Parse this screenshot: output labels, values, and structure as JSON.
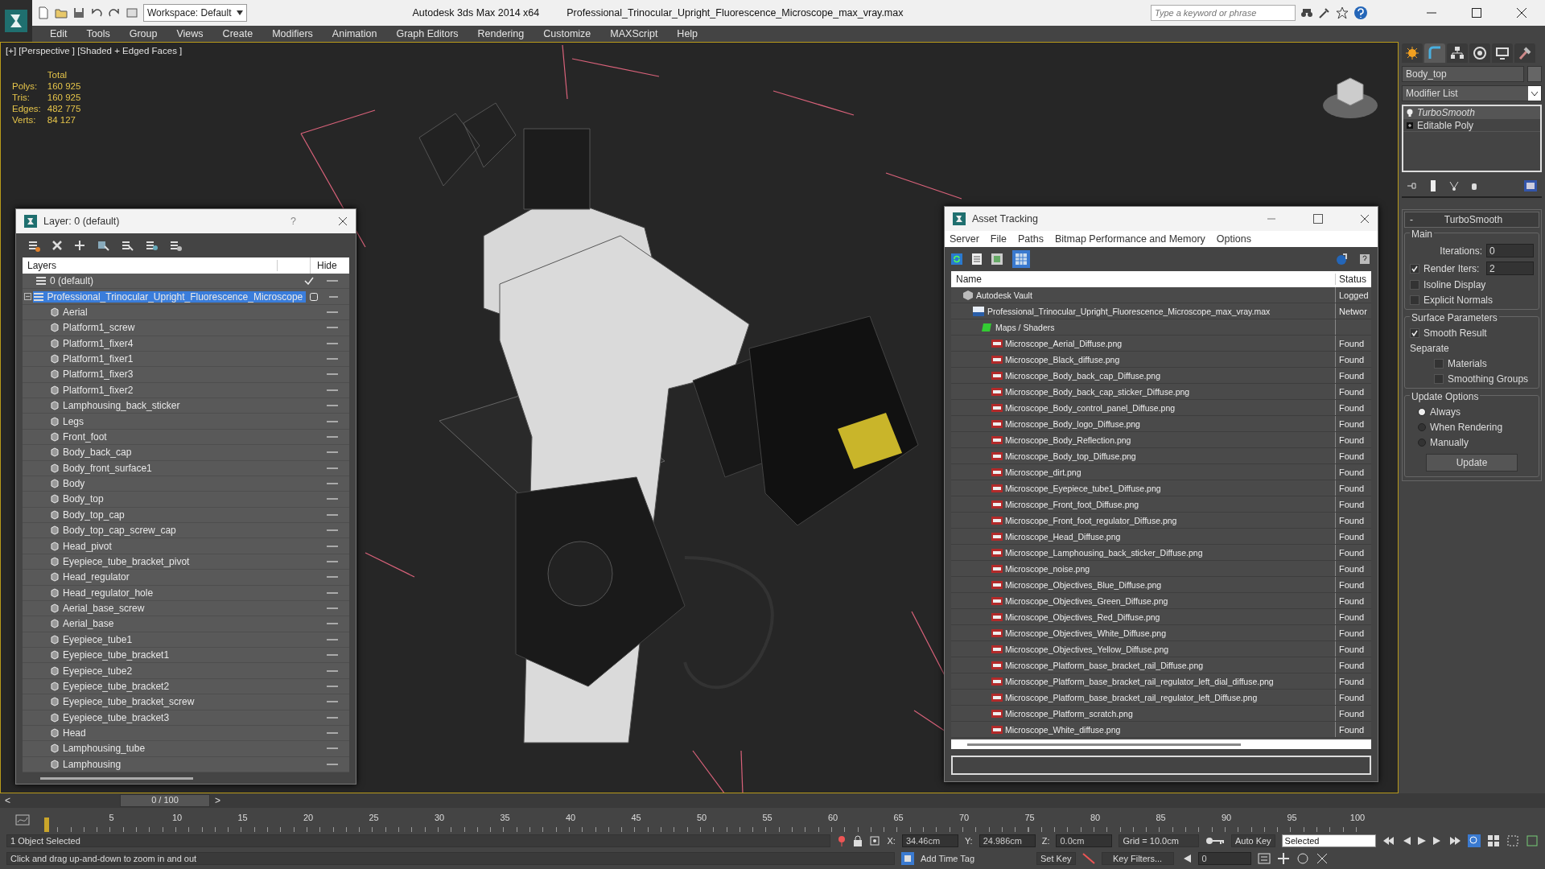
{
  "title_bar": {
    "workspace": "Workspace: Default",
    "app": "Autodesk 3ds Max  2014 x64",
    "file": "Professional_Trinocular_Upright_Fluorescence_Microscope_max_vray.max",
    "search": {
      "placeholder": "Type a keyword or phrase"
    }
  },
  "menu": [
    "Edit",
    "Tools",
    "Group",
    "Views",
    "Create",
    "Modifiers",
    "Animation",
    "Graph Editors",
    "Rendering",
    "Customize",
    "MAXScript",
    "Help"
  ],
  "viewport": {
    "label": "[+] [Perspective ] [Shaded + Edged Faces ]",
    "stats": {
      "heading": "Total",
      "rows": [
        {
          "label": "Polys:",
          "value": "160 925"
        },
        {
          "label": "Tris:",
          "value": "160 925"
        },
        {
          "label": "Edges:",
          "value": "482 775"
        },
        {
          "label": "Verts:",
          "value": "84 127"
        }
      ]
    }
  },
  "layer_window": {
    "title": "Layer: 0 (default)",
    "help": "?",
    "columns": [
      "Layers",
      "Hide"
    ],
    "layers": [
      {
        "name": "0 (default)",
        "selected": false,
        "active": true,
        "expanded": false
      },
      {
        "name": "Professional_Trinocular_Upright_Fluorescence_Microscope",
        "selected": true,
        "active": false,
        "expanded": true,
        "children": [
          {
            "name": "Aerial"
          },
          {
            "name": "Platform1_screw"
          },
          {
            "name": "Platform1_fixer4"
          },
          {
            "name": "Platform1_fixer1"
          },
          {
            "name": "Platform1_fixer3"
          },
          {
            "name": "Platform1_fixer2"
          },
          {
            "name": "Lamphousing_back_sticker"
          },
          {
            "name": "Legs"
          },
          {
            "name": "Front_foot"
          },
          {
            "name": "Body_back_cap"
          },
          {
            "name": "Body_front_surface1"
          },
          {
            "name": "Body"
          },
          {
            "name": "Body_top"
          },
          {
            "name": "Body_top_cap"
          },
          {
            "name": "Body_top_cap_screw_cap"
          },
          {
            "name": "Head_pivot"
          },
          {
            "name": "Eyepiece_tube_bracket_pivot"
          },
          {
            "name": "Head_regulator"
          },
          {
            "name": "Head_regulator_hole"
          },
          {
            "name": "Aerial_base_screw"
          },
          {
            "name": "Aerial_base"
          },
          {
            "name": "Eyepiece_tube1"
          },
          {
            "name": "Eyepiece_tube_bracket1"
          },
          {
            "name": "Eyepiece_tube2"
          },
          {
            "name": "Eyepiece_tube_bracket2"
          },
          {
            "name": "Eyepiece_tube_bracket_screw"
          },
          {
            "name": "Eyepiece_tube_bracket3"
          },
          {
            "name": "Head"
          },
          {
            "name": "Lamphousing_tube"
          },
          {
            "name": "Lamphousing"
          }
        ]
      }
    ]
  },
  "asset_window": {
    "title": "Asset Tracking",
    "menu": [
      "Server",
      "File",
      "Paths",
      "Bitmap Performance and Memory",
      "Options"
    ],
    "columns": [
      "Name",
      "Status"
    ],
    "assets": [
      {
        "kind": "vault",
        "name": "Autodesk Vault",
        "status": "Logged",
        "children": [
          {
            "kind": "max",
            "name": "Professional_Trinocular_Upright_Fluorescence_Microscope_max_vray.max",
            "status": "Networ",
            "children": [
              {
                "kind": "folder",
                "name": "Maps / Shaders",
                "children": [
                  {
                    "kind": "png",
                    "name": "Microscope_Aerial_Diffuse.png",
                    "status": "Found"
                  },
                  {
                    "kind": "png",
                    "name": "Microscope_Black_diffuse.png",
                    "status": "Found"
                  },
                  {
                    "kind": "png",
                    "name": "Microscope_Body_back_cap_Diffuse.png",
                    "status": "Found"
                  },
                  {
                    "kind": "png",
                    "name": "Microscope_Body_back_cap_sticker_Diffuse.png",
                    "status": "Found"
                  },
                  {
                    "kind": "png",
                    "name": "Microscope_Body_control_panel_Diffuse.png",
                    "status": "Found"
                  },
                  {
                    "kind": "png",
                    "name": "Microscope_Body_logo_Diffuse.png",
                    "status": "Found"
                  },
                  {
                    "kind": "png",
                    "name": "Microscope_Body_Reflection.png",
                    "status": "Found"
                  },
                  {
                    "kind": "png",
                    "name": "Microscope_Body_top_Diffuse.png",
                    "status": "Found"
                  },
                  {
                    "kind": "png",
                    "name": "Microscope_dirt.png",
                    "status": "Found"
                  },
                  {
                    "kind": "png",
                    "name": "Microscope_Eyepiece_tube1_Diffuse.png",
                    "status": "Found"
                  },
                  {
                    "kind": "png",
                    "name": "Microscope_Front_foot_Diffuse.png",
                    "status": "Found"
                  },
                  {
                    "kind": "png",
                    "name": "Microscope_Front_foot_regulator_Diffuse.png",
                    "status": "Found"
                  },
                  {
                    "kind": "png",
                    "name": "Microscope_Head_Diffuse.png",
                    "status": "Found"
                  },
                  {
                    "kind": "png",
                    "name": "Microscope_Lamphousing_back_sticker_Diffuse.png",
                    "status": "Found"
                  },
                  {
                    "kind": "png",
                    "name": "Microscope_noise.png",
                    "status": "Found"
                  },
                  {
                    "kind": "png",
                    "name": "Microscope_Objectives_Blue_Diffuse.png",
                    "status": "Found"
                  },
                  {
                    "kind": "png",
                    "name": "Microscope_Objectives_Green_Diffuse.png",
                    "status": "Found"
                  },
                  {
                    "kind": "png",
                    "name": "Microscope_Objectives_Red_Diffuse.png",
                    "status": "Found"
                  },
                  {
                    "kind": "png",
                    "name": "Microscope_Objectives_White_Diffuse.png",
                    "status": "Found"
                  },
                  {
                    "kind": "png",
                    "name": "Microscope_Objectives_Yellow_Diffuse.png",
                    "status": "Found"
                  },
                  {
                    "kind": "png",
                    "name": "Microscope_Platform_base_bracket_rail_Diffuse.png",
                    "status": "Found"
                  },
                  {
                    "kind": "png",
                    "name": "Microscope_Platform_base_bracket_rail_regulator_left_dial_diffuse.png",
                    "status": "Found"
                  },
                  {
                    "kind": "png",
                    "name": "Microscope_Platform_base_bracket_rail_regulator_left_Diffuse.png",
                    "status": "Found"
                  },
                  {
                    "kind": "png",
                    "name": "Microscope_Platform_scratch.png",
                    "status": "Found"
                  },
                  {
                    "kind": "png",
                    "name": "Microscope_White_diffuse.png",
                    "status": "Found"
                  }
                ]
              }
            ]
          }
        ]
      }
    ]
  },
  "command_panel": {
    "tabs": [
      {
        "kind": "create",
        "selected": false
      },
      {
        "kind": "modify",
        "selected": true
      },
      {
        "kind": "hierarchy",
        "selected": false
      },
      {
        "kind": "motion",
        "selected": false
      },
      {
        "kind": "display",
        "selected": false
      },
      {
        "kind": "utilities",
        "selected": false
      }
    ],
    "object_name": "Body_top",
    "modifier_list": "Modifier List",
    "stack": [
      {
        "name": "TurboSmooth",
        "selected": true
      },
      {
        "name": "Editable Poly",
        "selected": false
      }
    ],
    "rollout": {
      "toggle": "-",
      "title": "TurboSmooth",
      "main": {
        "title": "Main",
        "iterations": {
          "label": "Iterations:",
          "value": "0"
        },
        "render_iters": {
          "label": "Render Iters:",
          "value": "2",
          "checked": true
        },
        "options": [
          {
            "label": "Isoline Display",
            "checked": false
          },
          {
            "label": "Explicit Normals",
            "checked": false
          }
        ]
      },
      "surface": {
        "title": "Surface Parameters",
        "smooth_result": {
          "label": "Smooth Result",
          "checked": true
        },
        "separate": "Separate",
        "options": [
          {
            "label": "Materials",
            "checked": false
          },
          {
            "label": "Smoothing Groups",
            "checked": false
          }
        ]
      },
      "update": {
        "title": "Update Options",
        "radios": [
          {
            "label": "Always",
            "selected": true
          },
          {
            "label": "When Rendering",
            "selected": false
          },
          {
            "label": "Manually",
            "selected": false
          }
        ],
        "button": "Update"
      }
    }
  },
  "timeline": {
    "frame": "0 / 100",
    "prev": "<",
    "next": ">",
    "ticks": [
      "5",
      "10",
      "15",
      "20",
      "25",
      "30",
      "35",
      "40",
      "45",
      "50",
      "55",
      "60",
      "65",
      "70",
      "75",
      "80",
      "85",
      "90",
      "95",
      "100"
    ]
  },
  "status": {
    "selection": "1 Object Selected",
    "prompt": "Click and drag up-and-down to zoom in and out",
    "coords": [
      {
        "label": "X:",
        "value": "34.46cm"
      },
      {
        "label": "Y:",
        "value": "24.986cm"
      },
      {
        "label": "Z:",
        "value": "0.0cm"
      }
    ],
    "grid": "Grid = 10.0cm",
    "add_time_tag": "Add Time Tag",
    "auto_key": "Auto Key",
    "key_mode": "Selected",
    "set_key": "Set Key",
    "key_filters": "Key Filters...",
    "frame": "0"
  }
}
